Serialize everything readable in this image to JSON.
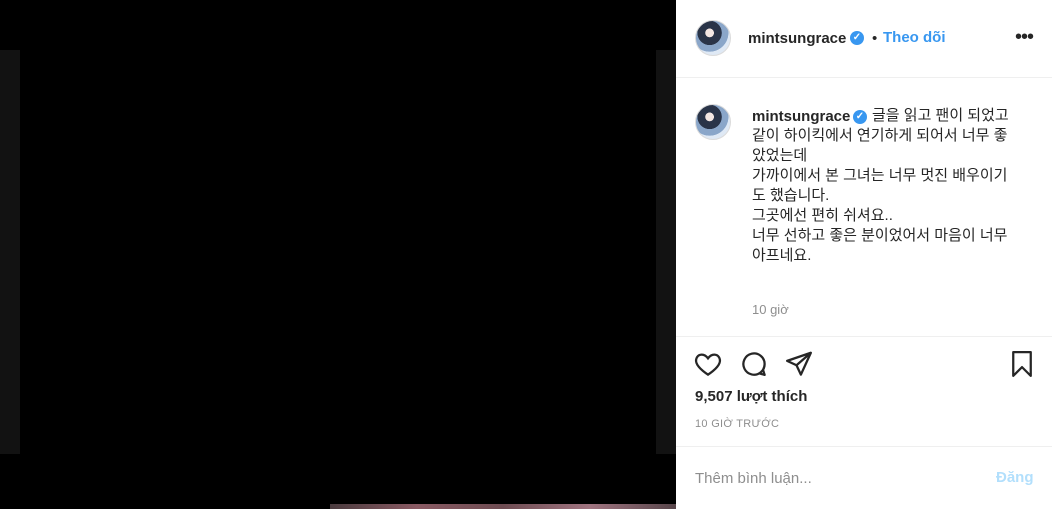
{
  "header": {
    "username": "mintsungrace",
    "separator": "•",
    "follow_label": "Theo dõi",
    "more_label": "•••"
  },
  "caption": {
    "username": "mintsungrace",
    "text": "글을 읽고 팬이 되었고\n같이 하이킥에서 연기하게 되어서 너무 좋았었는데\n가까이에서 본 그녀는 너무 멋진 배우이기도 했습니다.\n그곳에선 편히 쉬셔요..\n너무 선하고 좋은 분이었어서 마음이 너무 아프네요.",
    "time": "10 giờ"
  },
  "actions": {
    "icons": [
      "heart-icon",
      "comment-icon",
      "share-icon",
      "bookmark-icon"
    ]
  },
  "likes": "9,507 lượt thích",
  "timestamp": "10 GIỜ TRƯỚC",
  "comment": {
    "placeholder": "Thêm bình luận...",
    "post_label": "Đăng"
  },
  "colors": {
    "accent": "#3897f0",
    "post_disabled": "#b2dffc",
    "text": "#262626",
    "muted": "#8e8e8e"
  }
}
